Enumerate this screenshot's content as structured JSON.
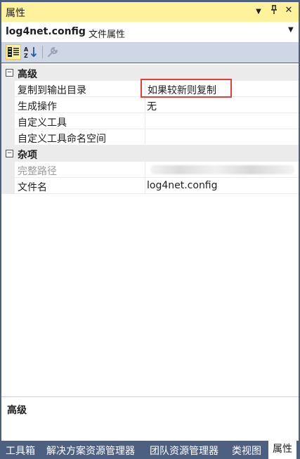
{
  "panel": {
    "title": "属性"
  },
  "window_controls": {
    "dropdown": "▼",
    "pin": "Д",
    "close": "✕"
  },
  "selector": {
    "object_name": "log4net.config",
    "object_type": "文件属性"
  },
  "toolbar": {
    "categorized": "categorized-icon",
    "alphabetical": "sort-az-icon",
    "property_pages": "wrench-icon"
  },
  "grid": {
    "categories": [
      {
        "label": "高级",
        "toggle": "−",
        "properties": [
          {
            "name": "复制到输出目录",
            "value": "如果较新则复制"
          },
          {
            "name": "生成操作",
            "value": "无"
          },
          {
            "name": "自定义工具",
            "value": ""
          },
          {
            "name": "自定义工具命名空间",
            "value": ""
          }
        ]
      },
      {
        "label": "杂项",
        "toggle": "−",
        "properties": [
          {
            "name": "完整路径",
            "value": ""
          },
          {
            "name": "文件名",
            "value": "log4net.config"
          }
        ]
      }
    ]
  },
  "description": {
    "heading": "高级"
  },
  "tabs": [
    {
      "label": "工具箱"
    },
    {
      "label": "解决方案资源管理器"
    },
    {
      "label": "团队资源管理器"
    },
    {
      "label": "类视图"
    },
    {
      "label": "属性",
      "active": true
    }
  ],
  "colors": {
    "title_bg": "#fff29d",
    "frame": "#4d6082",
    "toolbar_bg": "#cfd6e5",
    "highlight_box": "#e53e3e"
  }
}
